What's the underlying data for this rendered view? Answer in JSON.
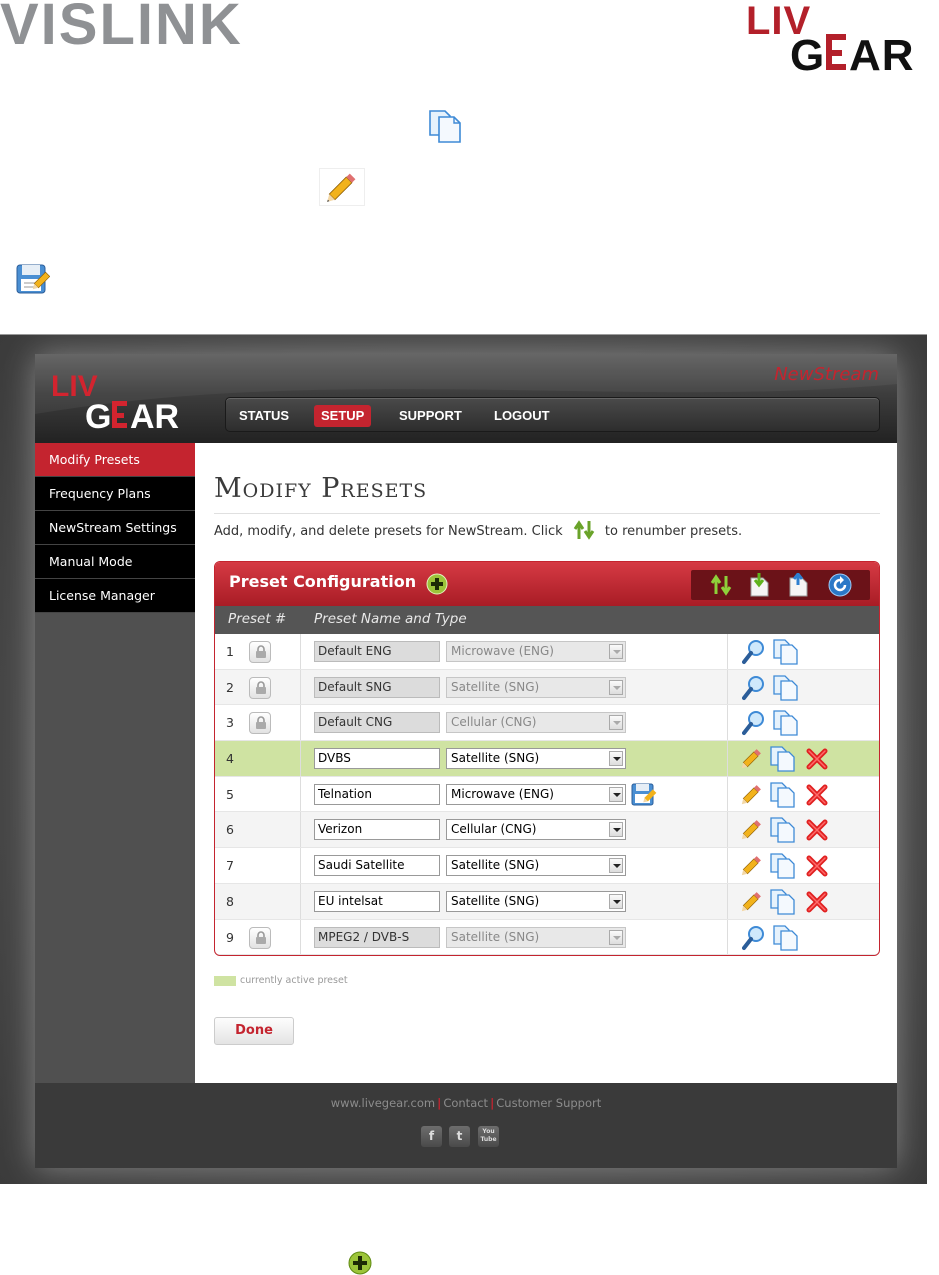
{
  "document": {
    "vislink_logo": "VISLINK",
    "livegear_logo": "LIVEGEAR",
    "icons": [
      "copy-icon",
      "pencil-icon",
      "save-icon",
      "add-icon"
    ]
  },
  "app": {
    "logo": "LIVEGEAR",
    "brand": "NewStream",
    "nav": [
      {
        "label": "STATUS",
        "active": false
      },
      {
        "label": "SETUP",
        "active": true
      },
      {
        "label": "SUPPORT",
        "active": false
      },
      {
        "label": "LOGOUT",
        "active": false
      }
    ],
    "sidebar": [
      {
        "label": "Modify Presets",
        "active": true
      },
      {
        "label": "Frequency Plans",
        "active": false
      },
      {
        "label": "NewStream Settings",
        "active": false
      },
      {
        "label": "Manual Mode",
        "active": false
      },
      {
        "label": "License Manager",
        "active": false
      }
    ],
    "page_title": "Modify Presets",
    "intro_before": "Add, modify, and delete presets for NewStream. Click",
    "intro_after": "to renumber presets.",
    "panel": {
      "title": "Preset Configuration",
      "col_preset": "Preset #",
      "col_name": "Preset Name and Type",
      "toolbar": [
        "renumber-icon",
        "import-icon",
        "export-icon",
        "refresh-icon"
      ]
    },
    "presets": [
      {
        "num": "1",
        "name": "Default ENG",
        "type": "Microwave (ENG)",
        "locked": true,
        "active": false,
        "unsaved": false
      },
      {
        "num": "2",
        "name": "Default SNG",
        "type": "Satellite (SNG)",
        "locked": true,
        "active": false,
        "unsaved": false
      },
      {
        "num": "3",
        "name": "Default CNG",
        "type": "Cellular (CNG)",
        "locked": true,
        "active": false,
        "unsaved": false
      },
      {
        "num": "4",
        "name": "DVBS",
        "type": "Satellite (SNG)",
        "locked": false,
        "active": true,
        "unsaved": false
      },
      {
        "num": "5",
        "name": "Telnation",
        "type": "Microwave (ENG)",
        "locked": false,
        "active": false,
        "unsaved": true
      },
      {
        "num": "6",
        "name": "Verizon",
        "type": "Cellular (CNG)",
        "locked": false,
        "active": false,
        "unsaved": false
      },
      {
        "num": "7",
        "name": "Saudi Satellite",
        "type": "Satellite (SNG)",
        "locked": false,
        "active": false,
        "unsaved": false
      },
      {
        "num": "8",
        "name": "EU intelsat",
        "type": "Satellite (SNG)",
        "locked": false,
        "active": false,
        "unsaved": false
      },
      {
        "num": "9",
        "name": "MPEG2 / DVB-S",
        "type": "Satellite (SNG)",
        "locked": true,
        "active": false,
        "unsaved": false
      }
    ],
    "legend": "currently active preset",
    "done_label": "Done",
    "footer": {
      "links": [
        "www.livegear.com",
        "Contact",
        "Customer Support"
      ],
      "social": [
        {
          "name": "facebook-icon",
          "glyph": "f"
        },
        {
          "name": "twitter-icon",
          "glyph": "t"
        },
        {
          "name": "youtube-icon",
          "glyph": "You Tube"
        }
      ]
    }
  },
  "colors": {
    "brand_red": "#c4242f",
    "active_row": "#cfe3a2",
    "nav_bg": "#2d2d2d",
    "sidebar_bg": "#000000"
  }
}
